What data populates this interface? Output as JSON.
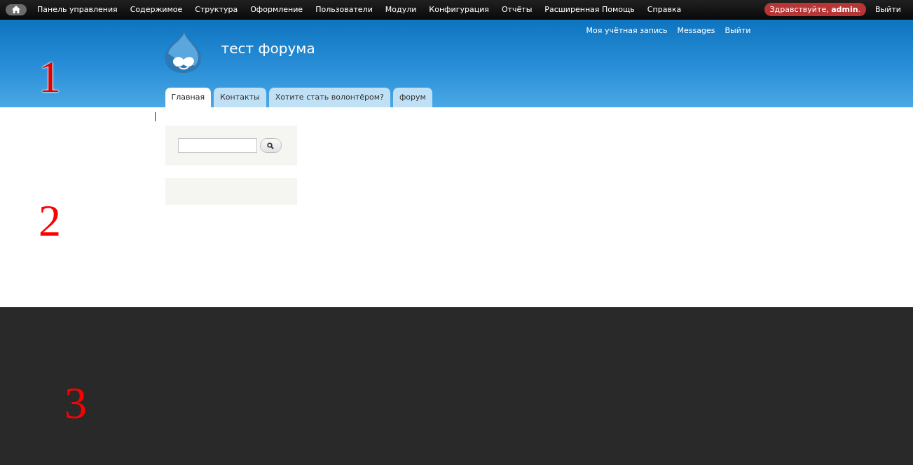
{
  "toolbar": {
    "menu": [
      {
        "label": "Панель управления"
      },
      {
        "label": "Содержимое"
      },
      {
        "label": "Структура"
      },
      {
        "label": "Оформление"
      },
      {
        "label": "Пользователи"
      },
      {
        "label": "Модули"
      },
      {
        "label": "Конфигурация"
      },
      {
        "label": "Отчёты"
      },
      {
        "label": "Расширенная Помощь"
      },
      {
        "label": "Справка"
      }
    ],
    "greeting": "Здравствуйте, **admin**.",
    "logout": "Выйти"
  },
  "header": {
    "site_name": "тест форума",
    "secondary_menu": [
      "Моя учётная запись",
      "Messages",
      "Выйти"
    ],
    "tabs": [
      {
        "label": "Главная",
        "selected": true
      },
      {
        "label": "Контакты",
        "selected": false
      },
      {
        "label": "Хотите стать волонтёром?",
        "selected": false
      },
      {
        "label": "форум",
        "selected": false
      }
    ]
  },
  "annotations": [
    "1",
    "2",
    "3"
  ]
}
